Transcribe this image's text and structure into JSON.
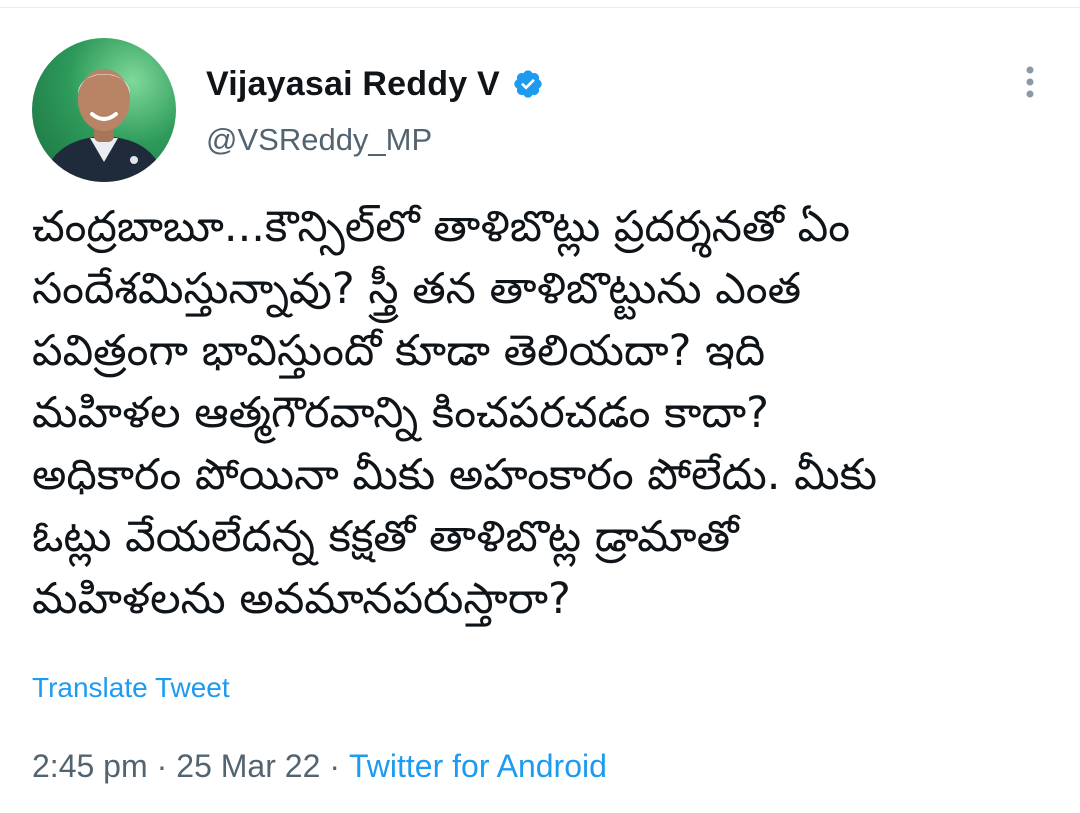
{
  "tweet": {
    "author": {
      "display_name": "Vijayasai Reddy V",
      "handle": "@VSReddy_MP",
      "verified": true,
      "avatar_icon": "profile-photo"
    },
    "text_lines": [
      "చంద్రబాబూ...కౌన్సిల్‌లో తాళిబొట్లు ప్రదర్శనతో ఏం",
      "సందేశమిస్తున్నావు?  స్త్రీ తన తాళిబొట్టును ఎంత",
      "పవిత్రంగా భావిస్తుందో కూడా తెలియదా? ఇది",
      "మహిళల ఆత్మగౌరవాన్ని కించపరచడం కాదా?",
      "అధికారం పోయినా మీకు అహంకారం పోలేదు. మీకు",
      "ఓట్లు వేయలేదన్న కక్షతో తాళిబొట్ల డ్రామాతో",
      "మహిళలను అవమానపరుస్తారా?"
    ],
    "translate_label": "Translate Tweet",
    "time": "2:45 pm",
    "separator": "·",
    "date": "25 Mar 22",
    "source": "Twitter for Android"
  },
  "icons": {
    "verified": "verified-badge-icon",
    "more": "more-vertical-icon"
  },
  "colors": {
    "accent": "#1d9bf0",
    "text_primary": "#0f1419",
    "text_secondary": "#536471"
  }
}
